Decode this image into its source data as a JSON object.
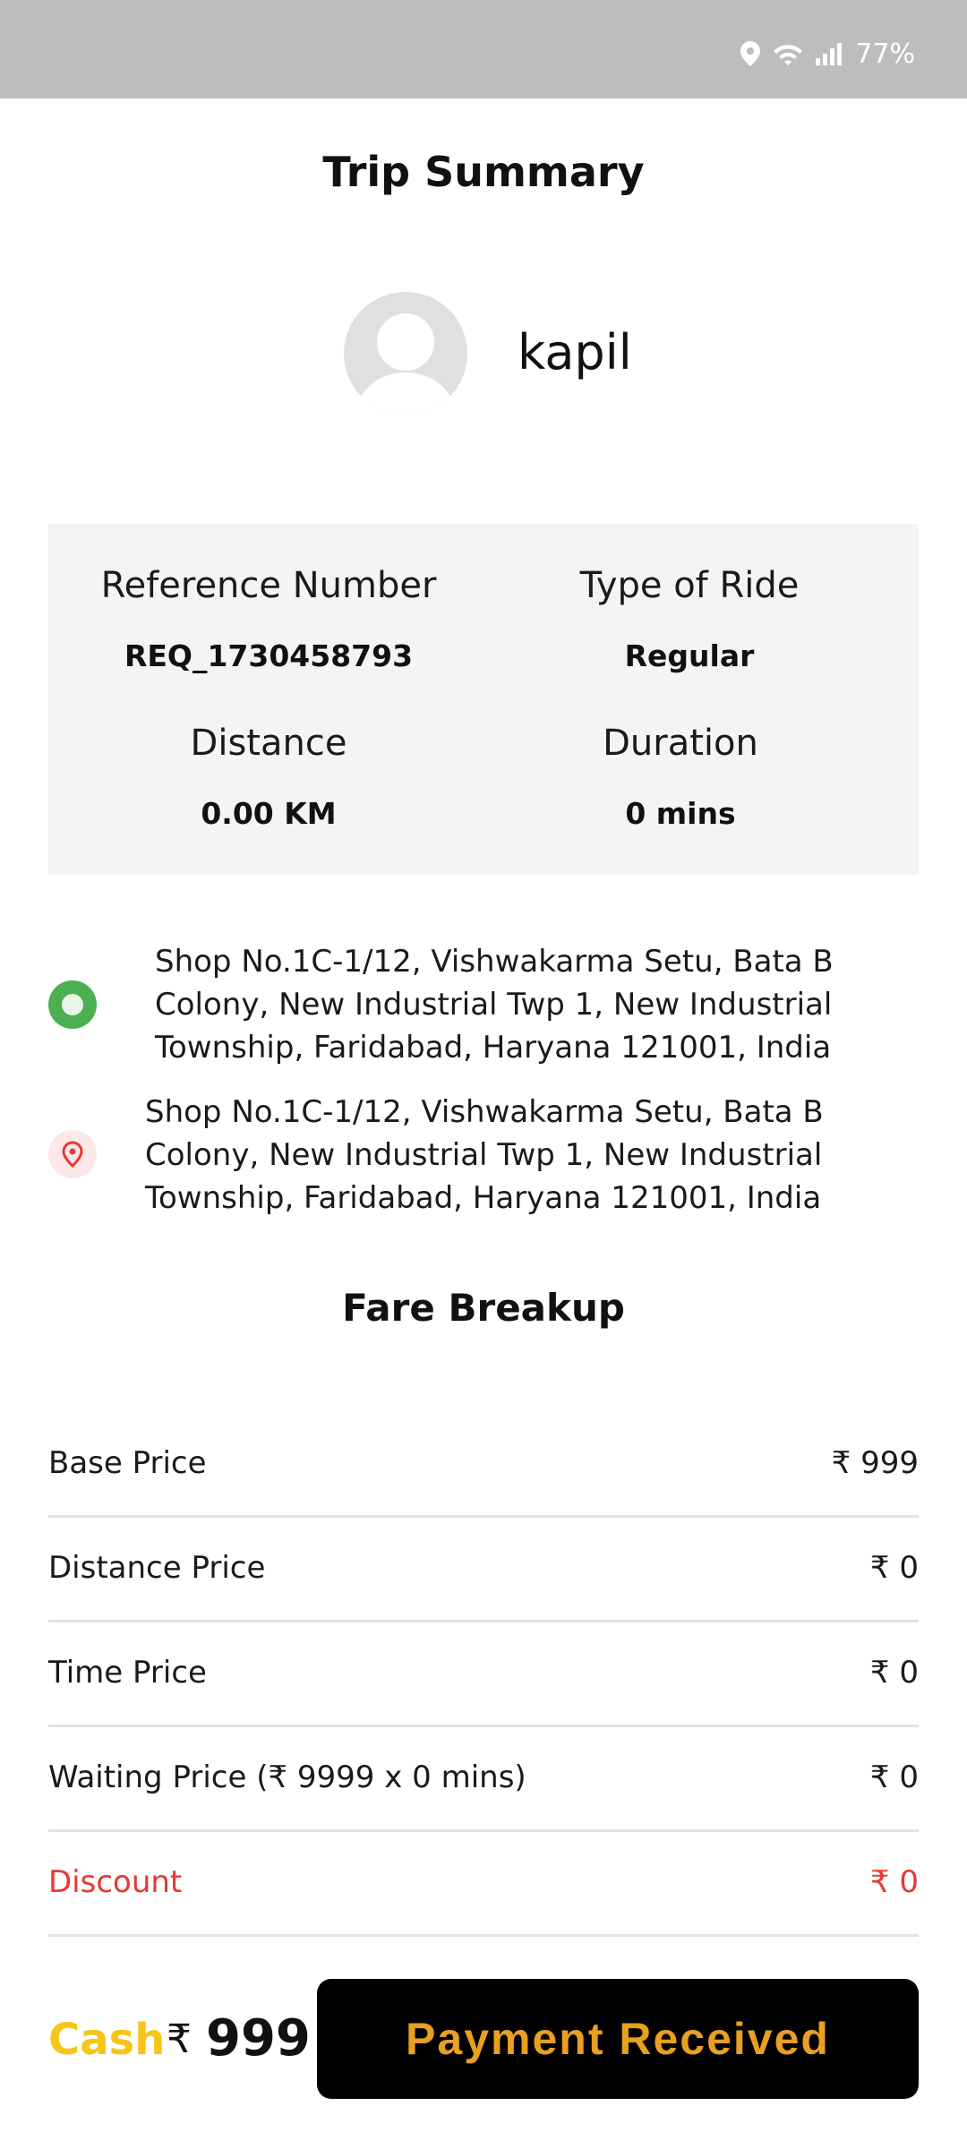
{
  "status_bar": {
    "battery": "77%",
    "icons": [
      "location-icon",
      "wifi-icon",
      "signal-icon"
    ]
  },
  "header": {
    "title": "Trip Summary"
  },
  "rider": {
    "name": "kapil"
  },
  "trip_info": {
    "reference_label": "Reference Number",
    "reference_value": "REQ_1730458793",
    "ride_type_label": "Type of Ride",
    "ride_type_value": "Regular",
    "distance_label": "Distance",
    "distance_value": "0.00 KM",
    "duration_label": "Duration",
    "duration_value": "0 mins"
  },
  "route": {
    "pickup_lines": [
      "Shop No.1C-1/12, Vishwakarma Setu, Bata B",
      "Colony, New Industrial Twp 1, New Industrial",
      "Township, Faridabad, Haryana 121001, India"
    ],
    "drop_lines": [
      "Shop No.1C-1/12, Vishwakarma Setu, Bata B",
      "Colony, New Industrial Twp 1, New Industrial",
      "Township, Faridabad, Haryana 121001, India"
    ]
  },
  "fare": {
    "title": "Fare Breakup",
    "rows": [
      {
        "label": "Base Price",
        "value": "₹ 999"
      },
      {
        "label": "Distance Price",
        "value": "₹ 0"
      },
      {
        "label": "Time Price",
        "value": "₹ 0"
      },
      {
        "label": "Waiting Price (₹ 9999 x 0 mins)",
        "value": "₹ 0"
      },
      {
        "label": "Discount",
        "value": "₹ 0"
      }
    ]
  },
  "payment": {
    "method": "Cash",
    "currency": "₹",
    "amount": "999",
    "button_label": "Payment Received"
  },
  "colors": {
    "accent_yellow": "#f5c518",
    "button_text": "#e8a020",
    "discount_red": "#e53935",
    "pickup_green": "#4caf50"
  }
}
